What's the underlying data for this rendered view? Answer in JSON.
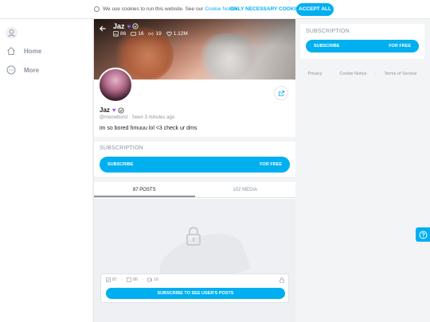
{
  "cookie": {
    "text": "We use cookies to run this website. See our",
    "link": "Cookie Notice",
    "only_necessary": "ONLY NECESSARY COOKIES",
    "accept_all": "ACCEPT ALL"
  },
  "nav": {
    "items": [
      {
        "label": "Home",
        "icon": "home-icon"
      },
      {
        "label": "More",
        "icon": "more-icon"
      }
    ]
  },
  "profile": {
    "name": "Jaz",
    "handle": "@meowburst",
    "seen": "Seen 3 minutes ago",
    "bio": "im so bored hmuuu lol <3 check ur dms",
    "stats": {
      "photos": "86",
      "videos": "16",
      "streams": "19",
      "likes": "1.12M"
    }
  },
  "subscription": {
    "title": "SUBSCRIPTION",
    "button_label": "SUBSCRIBE",
    "price": "FOR FREE"
  },
  "tabs": [
    {
      "label": "87 POSTS",
      "active": true
    },
    {
      "label": "102 MEDIA",
      "active": false
    }
  ],
  "locked": {
    "posts_count": "87",
    "photos_count": "86",
    "videos_count": "16",
    "button_label": "SUBSCRIBE TO SEE USER'S POSTS"
  },
  "sidebar": {
    "subscription_title": "SUBSCRIPTION",
    "button_label": "SUBSCRIBE",
    "price": "FOR FREE"
  },
  "footer": {
    "links": [
      "Privacy",
      "Cookie Notice",
      "Terms of Service"
    ]
  },
  "colors": {
    "accent": "#00aff0",
    "muted": "#8a96a3"
  }
}
